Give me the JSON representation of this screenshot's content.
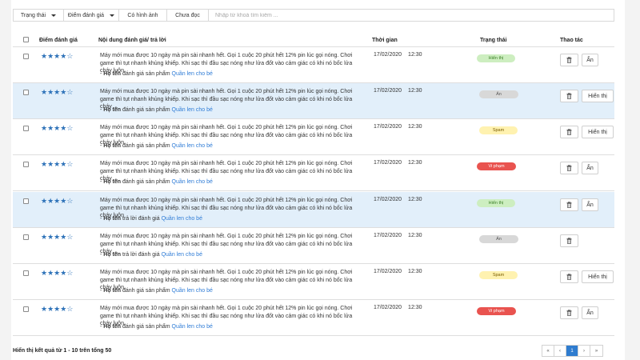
{
  "filters": {
    "status_label": "Trạng thái",
    "rating_label": "Điểm đánh giá",
    "has_image_label": "Có hình ảnh",
    "unread_label": "Chưa đọc",
    "search_placeholder": "Nhập từ khoá tìm kiếm ..."
  },
  "table": {
    "headers": {
      "rating": "Điểm đánh giá",
      "content": "Nội dung đánh giá/ trả lời",
      "time": "Thời gian",
      "status": "Trạng thái",
      "actions": "Thao tác"
    },
    "rows": [
      {
        "stars": 4,
        "review": "Máy mới mua được 10 ngày mà pin sài nhanh hết. Gọi 1 cuộc 20 phút hết 12% pin lúc gọi nóng. Chơi game thì tụt nhanh khủng khiếp. Khi sạc thì đầu sạc nóng như lửa đốt vào cảm giác có khi nó bốc lửa cháy luôn",
        "name": "Họ tên",
        "action_text": "đánh giá sản phẩm",
        "product": "Quần len cho bé",
        "date": "17/02/2020",
        "time": "12:30",
        "status": "Hiển thị",
        "status_type": "shown",
        "toggle_label": "Ẩn",
        "highlight": false
      },
      {
        "stars": 4,
        "review": "Máy mới mua được 10 ngày mà pin sài nhanh hết. Gọi 1 cuộc 20 phút hết 12% pin lúc gọi nóng. Chơi game thì tụt nhanh khủng khiếp. Khi sạc thì đầu sạc nóng như lửa đốt vào cảm giác có khi nó bốc lửa cháy ...",
        "name": "Họ tên",
        "action_text": "đánh giá sản phẩm",
        "product": "Quần len cho bé",
        "date": "17/02/2020",
        "time": "12:30",
        "status": "Ẩn",
        "status_type": "hidden",
        "toggle_label": "Hiển thị",
        "highlight": true
      },
      {
        "stars": 4,
        "review": "Máy mới mua được 10 ngày mà pin sài nhanh hết. Gọi 1 cuộc 20 phút hết 12% pin lúc gọi nóng. Chơi game thì tụt nhanh khủng khiếp. Khi sạc thì đầu sạc nóng như lửa đốt vào cảm giác có khi nó bốc lửa cháy luôn",
        "name": "Họ tên",
        "action_text": "đánh giá sản phẩm",
        "product": "Quần len cho bé",
        "date": "17/02/2020",
        "time": "12:30",
        "status": "Spam",
        "status_type": "spam",
        "toggle_label": "Hiển thị",
        "highlight": false
      },
      {
        "stars": 4,
        "review": "Máy mới mua được 10 ngày mà pin sài nhanh hết. Gọi 1 cuộc 20 phút hết 12% pin lúc gọi nóng. Chơi game thì tụt nhanh khủng khiếp. Khi sạc thì đầu sạc nóng như lửa đốt vào cảm giác có khi nó bốc lửa cháy ...",
        "name": "Họ tên",
        "action_text": "đánh giá sản phẩm",
        "product": "Quần len cho bé",
        "date": "17/02/2020",
        "time": "12:30",
        "status": "Vi phạm",
        "status_type": "violation",
        "toggle_label": "Ẩn",
        "highlight": false
      },
      {
        "stars": 4,
        "review": "Máy mới mua được 10 ngày mà pin sài nhanh hết. Gọi 1 cuộc 20 phút hết 12% pin lúc gọi nóng. Chơi game thì tụt nhanh khủng khiếp. Khi sạc thì đầu sạc nóng như lửa đốt vào cảm giác có khi nó bốc lửa cháy luôn",
        "name": "Họ tên",
        "action_text": "trả lời đánh giá",
        "product": "Quần len cho bé",
        "date": "17/02/2020",
        "time": "12:30",
        "status": "Hiển thị",
        "status_type": "shown",
        "toggle_label": "Ẩn",
        "highlight": true
      },
      {
        "stars": 4,
        "review": "Máy mới mua được 10 ngày mà pin sài nhanh hết. Gọi 1 cuộc 20 phút hết 12% pin lúc gọi nóng. Chơi game thì tụt nhanh khủng khiếp. Khi sạc thì đầu sạc nóng như lửa đốt vào cảm giác có khi nó bốc lửa cháy ...",
        "name": "Họ tên",
        "action_text": "trả lời đánh giá",
        "product": "Quần len cho bé",
        "date": "17/02/2020",
        "time": "12:30",
        "status": "Ẩn",
        "status_type": "hidden",
        "toggle_label": "",
        "highlight": false
      },
      {
        "stars": 4,
        "review": "Máy mới mua được 10 ngày mà pin sài nhanh hết. Gọi 1 cuộc 20 phút hết 12% pin lúc gọi nóng. Chơi game thì tụt nhanh khủng khiếp. Khi sạc thì đầu sạc nóng như lửa đốt vào cảm giác có khi nó bốc lửa cháy luôn",
        "name": "Họ tên",
        "action_text": "đánh giá sản phẩm",
        "product": "Quần len cho bé",
        "date": "17/02/2020",
        "time": "12:30",
        "status": "Spam",
        "status_type": "spam",
        "toggle_label": "Hiển thị",
        "highlight": false
      },
      {
        "stars": 4,
        "review": "Máy mới mua được 10 ngày mà pin sài nhanh hết. Gọi 1 cuộc 20 phút hết 12% pin lúc gọi nóng. Chơi game thì tụt nhanh khủng khiếp. Khi sạc thì đầu sạc nóng như lửa đốt vào cảm giác có khi nó bốc lửa cháy luôn",
        "name": "Họ tên",
        "action_text": "đánh giá sản phẩm",
        "product": "Quần len cho bé",
        "date": "17/02/2020",
        "time": "12:30",
        "status": "Vi phạm",
        "status_type": "violation",
        "toggle_label": "Ẩn",
        "highlight": false
      }
    ]
  },
  "footer": {
    "summary": "Hiển thị kết quả từ 1 - 10 trên tổng 50",
    "pager": {
      "first": "«",
      "prev": "‹",
      "current": "1",
      "next": "›",
      "last": "»"
    }
  },
  "colors": {
    "accent": "#2f7ccf",
    "row_highlight": "#e2effa",
    "link": "#2f7cd6"
  },
  "icons": {
    "delete": "trash-icon",
    "dropdown": "caret-down-icon",
    "rating": "star-icon"
  }
}
